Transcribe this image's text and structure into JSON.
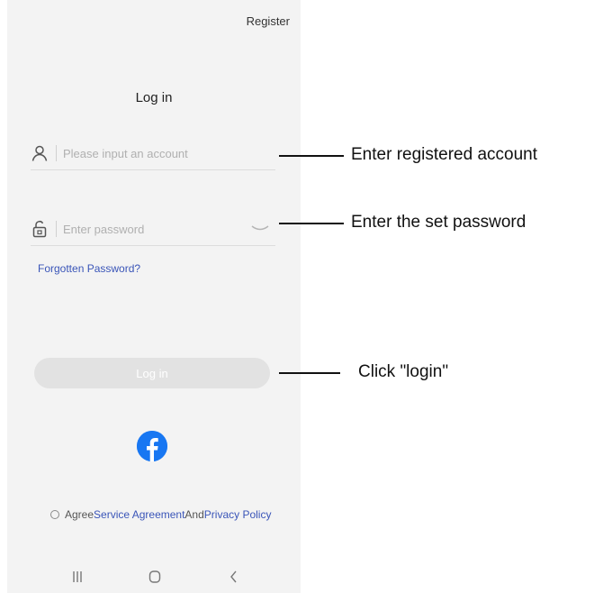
{
  "header": {
    "register_label": "Register"
  },
  "main": {
    "title": "Log in",
    "account_field": {
      "placeholder": "Please input an account",
      "value": ""
    },
    "password_field": {
      "placeholder": "Enter password",
      "value": ""
    },
    "forgot_label": "Forgotten Password?",
    "login_button_label": "Log in",
    "social_login_icon": "facebook-icon"
  },
  "agreement": {
    "prefix": "Agree",
    "service_link": "Service Agreement",
    "joiner": "And",
    "privacy_link": "Privacy Policy"
  },
  "annotations": [
    {
      "text": "Enter registered account"
    },
    {
      "text": "Enter the set password"
    },
    {
      "text": "Click \"login\""
    }
  ],
  "colors": {
    "link": "#3a55b8",
    "facebook": "#1877f2",
    "login_button_disabled": "#e2e2e2",
    "phone_background": "#f3f3f3"
  }
}
